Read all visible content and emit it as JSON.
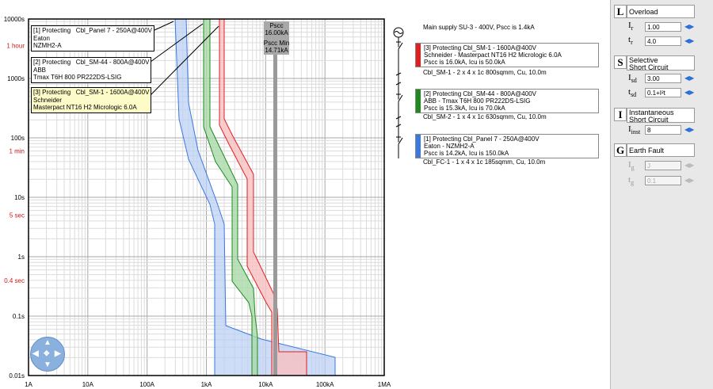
{
  "plot": {
    "y_labels": [
      "10000s",
      "1 hour",
      "1000s",
      "100s",
      "1 min",
      "10s",
      "5 sec",
      "1s",
      "0.4 sec",
      "0.1s",
      "0.01s"
    ],
    "x_labels": [
      "1A",
      "10A",
      "100A",
      "1kA",
      "10kA",
      "100kA",
      "1MA"
    ],
    "pscc_label": "Pscc\n16.00kA",
    "pscc_min_label": "Pscc Min\n14.71kA"
  },
  "labels": {
    "panel7": "[1] Protecting   Cbl_Panel 7 - 250A@400V\nEaton\nNZMH2-A",
    "sm44": "[2] Protecting   Cbl_SM-44 - 800A@400V\nABB\nTmax T6H 800 PR222DS-LSIG",
    "sm1": "[3] Protecting   Cbl_SM-1 - 1600A@400V\nSchneider\nMasterpact NT16 H2 Micrologic 6.0A"
  },
  "single_line": {
    "main_supply": "Main supply SU-3 - 400V, Pscc is 1.4kA",
    "devices": [
      {
        "line1": "[3] Protecting   Cbl_SM-1 - 1600A@400V",
        "line2": "Schneider - Masterpact NT16 H2 Micrologic 6.0A",
        "line3": "Pscc is 16.0kA, Icu is 50.0kA",
        "color": "#e02020"
      },
      {
        "line1": "[2] Protecting   Cbl_SM-44 - 800A@400V",
        "line2": "ABB - Tmax T6H 800 PR222DS-LSIG",
        "line3": "Pscc is 15.3kA, Icu is 70.0kA",
        "color": "#1e8a1e"
      },
      {
        "line1": "[1] Protecting   Cbl_Panel 7 - 250A@400V",
        "line2": "Eaton - NZMH2-A",
        "line3": "Pscc is 14.2kA, Icu is 150.0kA",
        "color": "#3b78e0"
      }
    ],
    "cables": [
      "Cbl_SM-1 - 2 x 4 x 1c 800sqmm, Cu, 10.0m",
      "Cbl_SM-2 - 1 x 4 x 1c 630sqmm, Cu, 10.0m",
      "Cbl_FC-1 - 1 x 4 x 1c 185sqmm, Cu, 10.0m"
    ]
  },
  "settings": {
    "L": {
      "letter": "L",
      "title": "Overload",
      "ir_label": "I",
      "ir_sub": "r",
      "ir_value": "1.00",
      "tr_label": "t",
      "tr_sub": "r",
      "tr_value": "4.0"
    },
    "S": {
      "letter": "S",
      "title": "Selective\nShort Circuit",
      "isd_label": "I",
      "isd_sub": "sd",
      "isd_value": "3.00",
      "tsd_label": "t",
      "tsd_sub": "sd",
      "tsd_value": "0.1+I²t"
    },
    "I": {
      "letter": "I",
      "title": "Instantaneous\nShort Circuit",
      "inst_label": "I",
      "inst_sub": "inst",
      "inst_value": "8"
    },
    "G": {
      "letter": "G",
      "title": "Earth Fault",
      "ig_label": "I",
      "ig_sub": "g",
      "ig_value": "J",
      "tg_label": "t",
      "tg_sub": "g",
      "tg_value": "0.1"
    }
  },
  "colors": {
    "red": "#e02020",
    "green": "#1e8a1e",
    "blue": "#3b78e0",
    "pscc": "#9a9a9a"
  }
}
